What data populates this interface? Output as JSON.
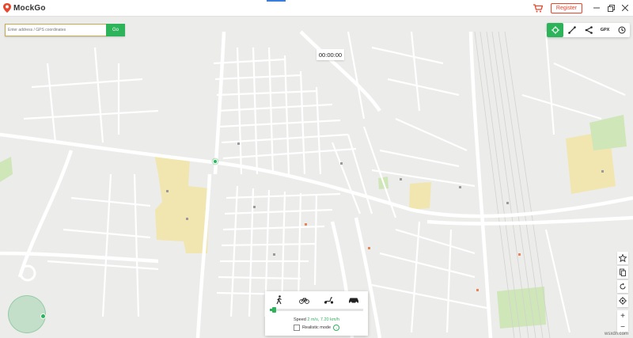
{
  "app": {
    "name": "MockGo",
    "register_label": "Register"
  },
  "icons": {
    "logo": "map-pin-icon",
    "cart": "cart-icon",
    "minimize": "minimize-icon",
    "restore": "restore-icon",
    "close": "close-icon",
    "teleport": "teleport-icon",
    "two_spot": "two-spot-route-icon",
    "multi_spot": "multi-spot-route-icon",
    "history": "history-icon",
    "favorite": "star-icon",
    "import": "import-gpx-icon",
    "reset": "reset-icon",
    "locate": "locate-icon",
    "walk": "walking-icon",
    "bike": "cycling-icon",
    "scooter": "scooter-icon",
    "car": "car-icon"
  },
  "search": {
    "placeholder": "Enter address / GPS coordinates",
    "value": "",
    "go_label": "Go"
  },
  "timer": "00:00:00",
  "toolbar": {
    "gpx_label": "GPX"
  },
  "zoom": {
    "in_label": "+",
    "out_label": "−"
  },
  "speed": {
    "label": "Speed",
    "value": "2 m/s, 7.20 km/h",
    "level": 0.04
  },
  "realistic_mode_label": "Realistic mode",
  "watermark": "wsxdn.com",
  "colors": {
    "accent": "#2db35a",
    "register": "#e8452b",
    "park": "#cfe6b8",
    "landuse": "#f1e6b0"
  }
}
